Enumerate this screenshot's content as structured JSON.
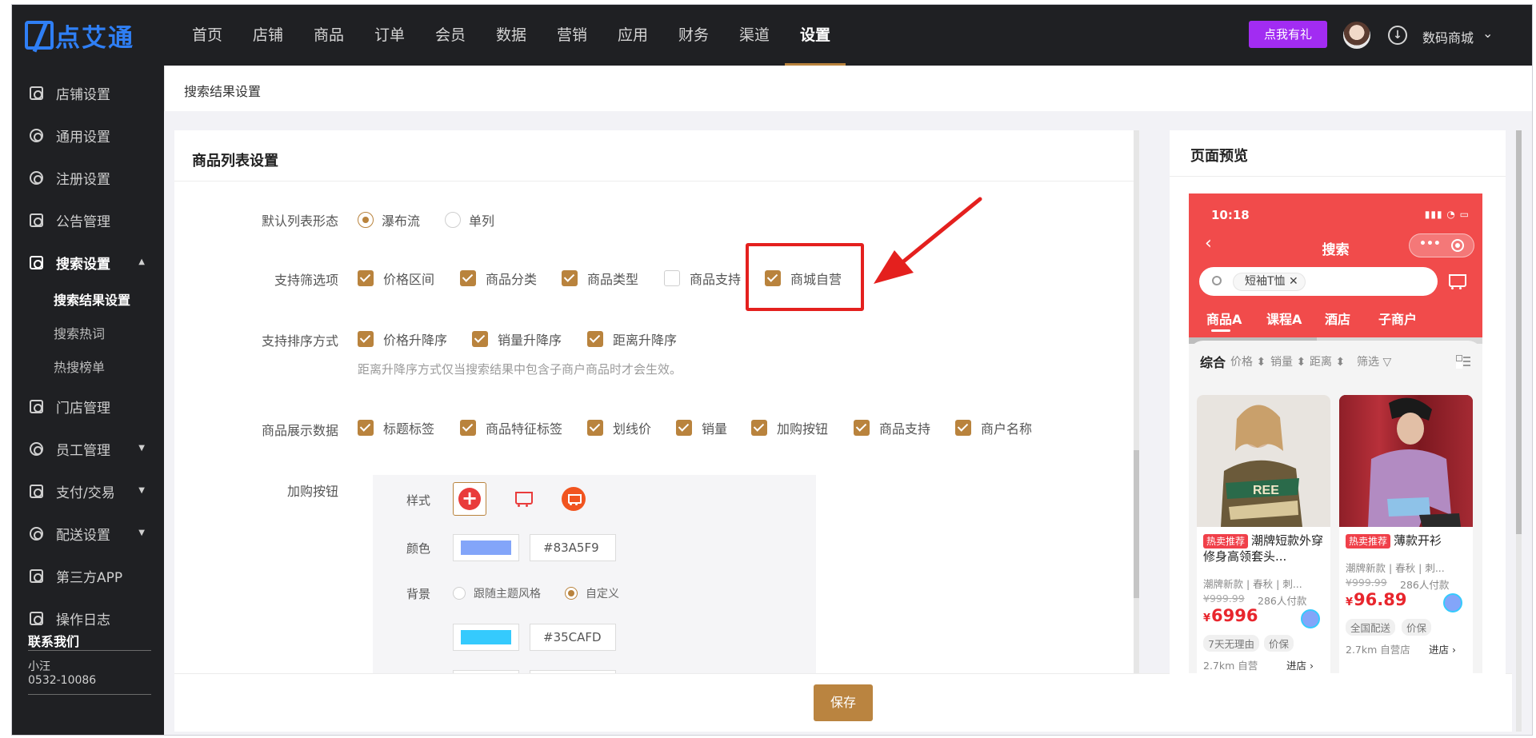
{
  "brand": {
    "logo_text": "点艾通"
  },
  "nav": {
    "items": [
      "首页",
      "店铺",
      "商品",
      "订单",
      "会员",
      "数据",
      "营销",
      "应用",
      "财务",
      "渠道",
      "设置"
    ],
    "active": "设置",
    "gift_button": "点我有礼",
    "shop_name": "数码商城"
  },
  "sidebar": {
    "items": [
      {
        "label": "店铺设置"
      },
      {
        "label": "通用设置"
      },
      {
        "label": "注册设置"
      },
      {
        "label": "公告管理"
      },
      {
        "label": "搜索设置"
      },
      {
        "label": "门店管理"
      },
      {
        "label": "员工管理"
      },
      {
        "label": "支付/交易"
      },
      {
        "label": "配送设置"
      },
      {
        "label": "第三方APP"
      },
      {
        "label": "操作日志"
      }
    ],
    "sub_items": [
      "搜索结果设置",
      "搜索热词",
      "热搜榜单"
    ],
    "contact": {
      "title": "联系我们",
      "name": "小汪",
      "phone": "0532-10086"
    }
  },
  "breadcrumb": "搜索结果设置",
  "settings": {
    "card_title": "商品列表设置",
    "list_form": {
      "label": "默认列表形态",
      "options": [
        "瀑布流",
        "单列"
      ],
      "selected": "瀑布流"
    },
    "filters": {
      "label": "支持筛选项",
      "options": [
        {
          "text": "价格区间",
          "checked": true
        },
        {
          "text": "商品分类",
          "checked": true
        },
        {
          "text": "商品类型",
          "checked": true
        },
        {
          "text": "商品支持",
          "checked": false
        },
        {
          "text": "商城自营",
          "checked": true
        }
      ]
    },
    "sorts": {
      "label": "支持排序方式",
      "options": [
        {
          "text": "价格升降序",
          "checked": true
        },
        {
          "text": "销量升降序",
          "checked": true
        },
        {
          "text": "距离升降序",
          "checked": true
        }
      ],
      "hint": "距离升降序方式仅当搜索结果中包含子商户商品时才会生效。"
    },
    "display": {
      "label": "商品展示数据",
      "options": [
        {
          "text": "标题标签",
          "checked": true
        },
        {
          "text": "商品特征标签",
          "checked": true
        },
        {
          "text": "划线价",
          "checked": true
        },
        {
          "text": "销量",
          "checked": true
        },
        {
          "text": "加购按钮",
          "checked": true
        },
        {
          "text": "商品支持",
          "checked": true
        },
        {
          "text": "商户名称",
          "checked": true
        }
      ]
    },
    "cart_button": {
      "label": "加购按钮",
      "style_label": "样式",
      "color_label": "颜色",
      "color_value": "#83A5F9",
      "bg_label": "背景",
      "bg_options": [
        "跟随主题风格",
        "自定义"
      ],
      "bg_selected": "自定义",
      "bg_value": "#35CAFD"
    },
    "save": "保存"
  },
  "preview": {
    "title": "页面预览",
    "time": "10:18",
    "page_title": "搜索",
    "search_tag": "短袖T恤",
    "tabs": [
      "商品A",
      "课程A",
      "酒店",
      "子商户"
    ],
    "sort": [
      "综合",
      "价格",
      "销量",
      "距离",
      "筛选"
    ],
    "products": [
      {
        "hot": "热卖推荐",
        "name": "潮牌短款外穿修身高领套头...",
        "sub": "潮牌新款 | 春秋 | 刺...",
        "orig": "¥999.99",
        "paid": "286人付款",
        "yen": "¥",
        "price": "6996",
        "tags": [
          "7天无理由",
          "价保"
        ],
        "meta": "2.7km 自营",
        "go": "进店"
      },
      {
        "hot": "热卖推荐",
        "name": "薄款开衫",
        "sub": "潮牌新款 | 春秋 | 刺...",
        "orig": "¥999.99",
        "paid": "286人付款",
        "yen": "¥",
        "price": "96.89",
        "tags": [
          "全国配送",
          "价保"
        ],
        "meta": "2.7km 自营店",
        "go": "进店"
      }
    ]
  },
  "colors": {
    "accent": "#B9833D",
    "nav_bg": "#1F2023",
    "gift": "#A22CF2",
    "preview_head": "#F14B4B",
    "highlight": "#E4201E"
  }
}
